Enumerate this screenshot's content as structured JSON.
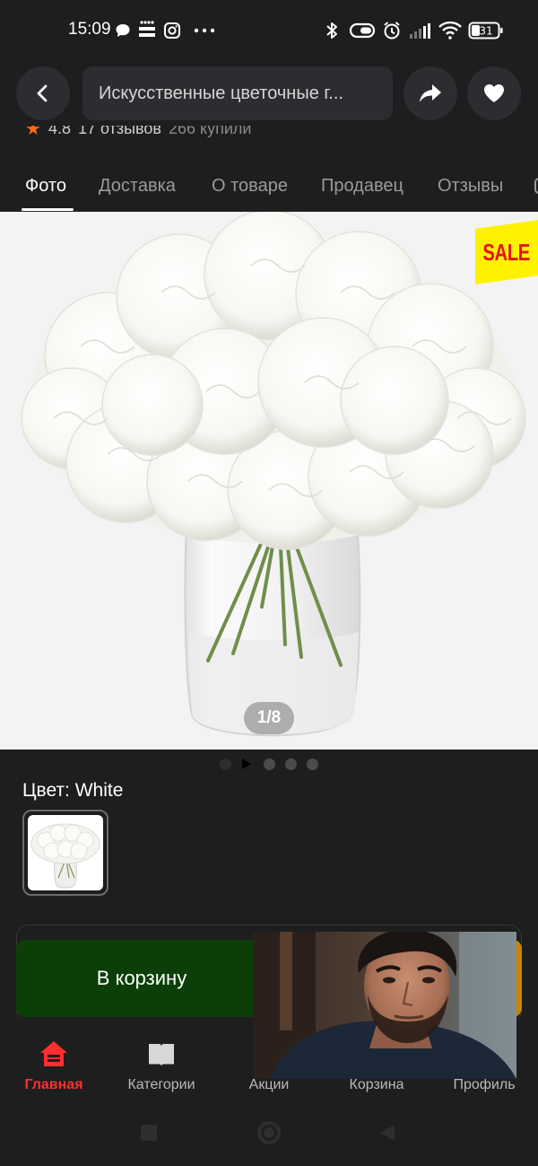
{
  "status_bar": {
    "time": "15:09",
    "battery": "31",
    "icons": [
      "chat-bubble-icon",
      "detmir-logo-icon",
      "instagram-icon",
      "more-dots-icon",
      "bluetooth-icon",
      "vibrate-icon",
      "alarm-icon",
      "signal-icon",
      "wifi-icon",
      "battery-icon"
    ]
  },
  "header": {
    "search_text": "Искусственные цветочные г...",
    "back_icon": "chevron-left-icon",
    "share_icon": "share-icon",
    "favorite_icon": "heart-icon"
  },
  "rating": {
    "score": "4.8",
    "reviews": "17 отзывов",
    "purchases": "266 купили"
  },
  "tabs": [
    "Фото",
    "Доставка",
    "О товаре",
    "Продавец",
    "Отзывы"
  ],
  "gallery": {
    "badge": "SALE",
    "counter": "1/8",
    "current_index": 1,
    "total": 8
  },
  "color": {
    "label": "Цвет: White"
  },
  "actions": {
    "cart_label": "В корзину"
  },
  "bottom_nav": {
    "items": [
      {
        "label": "Главная",
        "icon": "home-icon"
      },
      {
        "label": "Категории",
        "icon": "book-icon"
      },
      {
        "label": "Акции",
        "icon": "percent-icon"
      },
      {
        "label": "Корзина",
        "icon": "cart-icon"
      },
      {
        "label": "Профиль",
        "icon": "profile-icon"
      }
    ]
  },
  "colors": {
    "background": "#1e1e1f",
    "accent_red": "#ff2f2f",
    "cart_green": "#0c3f07",
    "sale_yellow": "#fff200"
  }
}
